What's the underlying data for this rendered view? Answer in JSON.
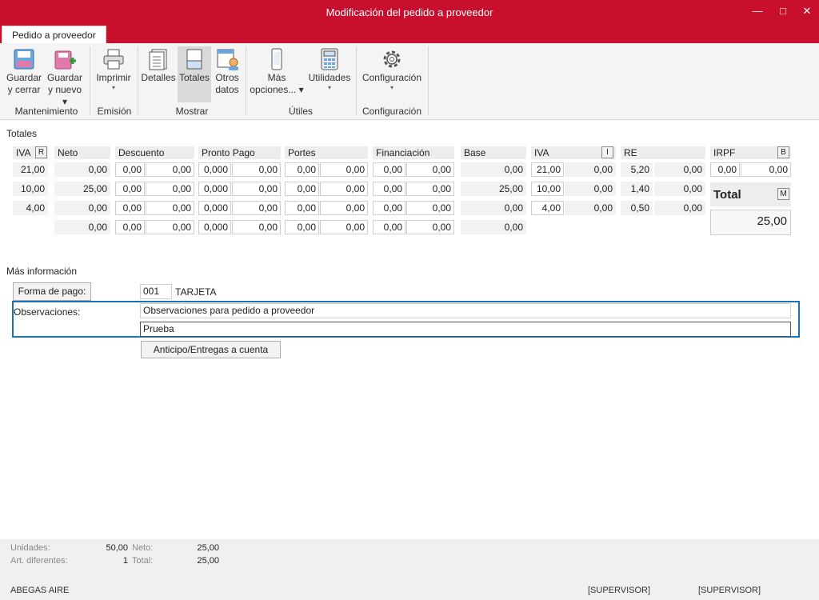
{
  "window": {
    "title": "Modificación del pedido a proveedor",
    "minimize_glyph": "—",
    "maximize_glyph": "□",
    "close_glyph": "✕"
  },
  "ribbon": {
    "tab": "Pedido a proveedor",
    "buttons": {
      "guardar_cerrar": [
        "Guardar",
        "y cerrar"
      ],
      "guardar_nuevo": [
        "Guardar",
        "y nuevo ▾"
      ],
      "imprimir": "Imprimir",
      "detalles": "Detalles",
      "totales": "Totales",
      "otros_datos": [
        "Otros",
        "datos"
      ],
      "mas_opciones": [
        "Más",
        "opciones... ▾"
      ],
      "utilidades": "Utilidades",
      "configuracion": "Configuración"
    },
    "groups": {
      "mantenimiento": "Mantenimiento",
      "emision": "Emisión",
      "mostrar": "Mostrar",
      "utiles": "Útiles",
      "configuracion": "Configuración"
    },
    "caret": "▾"
  },
  "totales": {
    "section_title": "Totales",
    "headers": {
      "iva": "IVA",
      "iva_btn": "R",
      "neto": "Neto",
      "descuento": "Descuento",
      "pronto_pago": "Pronto Pago",
      "portes": "Portes",
      "financiacion": "Financiación",
      "base": "Base",
      "iva2": "IVA",
      "iva2_btn": "I",
      "re": "RE",
      "irpf": "IRPF",
      "irpf_btn": "B"
    },
    "rows": [
      {
        "iva": "21,00",
        "neto": "0,00",
        "desc_pct": "0,00",
        "desc": "0,00",
        "pp_pct": "0,000",
        "pp": "0,00",
        "port_pct": "0,00",
        "port": "0,00",
        "fin_pct": "0,00",
        "fin": "0,00",
        "base": "0,00",
        "iva2_pct": "21,00",
        "iva2": "0,00",
        "re_pct": "5,20",
        "re": "0,00"
      },
      {
        "iva": "10,00",
        "neto": "25,00",
        "desc_pct": "0,00",
        "desc": "0,00",
        "pp_pct": "0,000",
        "pp": "0,00",
        "port_pct": "0,00",
        "port": "0,00",
        "fin_pct": "0,00",
        "fin": "0,00",
        "base": "25,00",
        "iva2_pct": "10,00",
        "iva2": "0,00",
        "re_pct": "1,40",
        "re": "0,00"
      },
      {
        "iva": "4,00",
        "neto": "0,00",
        "desc_pct": "0,00",
        "desc": "0,00",
        "pp_pct": "0,000",
        "pp": "0,00",
        "port_pct": "0,00",
        "port": "0,00",
        "fin_pct": "0,00",
        "fin": "0,00",
        "base": "0,00",
        "iva2_pct": "4,00",
        "iva2": "0,00",
        "re_pct": "0,50",
        "re": "0,00"
      }
    ],
    "sum_row": {
      "neto": "0,00",
      "desc_pct": "0,00",
      "desc": "0,00",
      "pp_pct": "0,000",
      "pp": "0,00",
      "port_pct": "0,00",
      "port": "0,00",
      "fin_pct": "0,00",
      "fin": "0,00",
      "base": "0,00"
    },
    "irpf": {
      "pct": "0,00",
      "value": "0,00"
    },
    "total": {
      "label": "Total",
      "btn": "M",
      "value": "25,00"
    }
  },
  "mas_info": {
    "section_title": "Más información",
    "forma_pago_btn": "Forma de pago:",
    "forma_pago_code": "001",
    "forma_pago_name": "TARJETA",
    "observaciones_label": "Observaciones:",
    "obs_line1": "Observaciones para pedido a proveedor",
    "obs_line2": "Prueba",
    "anticipo_btn": "Anticipo/Entregas a cuenta"
  },
  "footer": {
    "unidades_label": "Unidades:",
    "unidades": "50,00",
    "neto_label": "Neto:",
    "neto": "25,00",
    "art_label": "Art. diferentes:",
    "art": "1",
    "total_label": "Total:",
    "total": "25,00",
    "company": "ABEGAS AIRE",
    "user1": "[SUPERVISOR]",
    "user2": "[SUPERVISOR]"
  },
  "colors": {
    "accent": "#c8102e",
    "focus": "#1a73b8"
  }
}
